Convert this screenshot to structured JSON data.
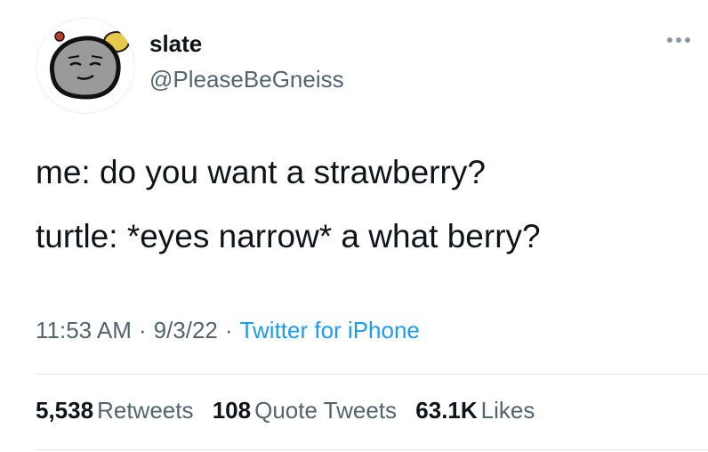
{
  "author": {
    "display_name": "slate",
    "handle": "@PleaseBeGneiss",
    "avatar_icon": "rock-character-avatar"
  },
  "tweet": {
    "lines": [
      "me: do you want a strawberry?",
      "turtle: *eyes narrow* a what berry?"
    ],
    "time": "11:53 AM",
    "date": "9/3/22",
    "source": "Twitter for iPhone",
    "separator": "·"
  },
  "stats": {
    "retweets_count": "5,538",
    "retweets_label": "Retweets",
    "quotes_count": "108",
    "quotes_label": "Quote Tweets",
    "likes_count": "63.1K",
    "likes_label": "Likes"
  },
  "colors": {
    "text": "#0f1419",
    "secondary": "#536471",
    "link": "#1d9bf0",
    "divider": "#e1e8ed"
  }
}
